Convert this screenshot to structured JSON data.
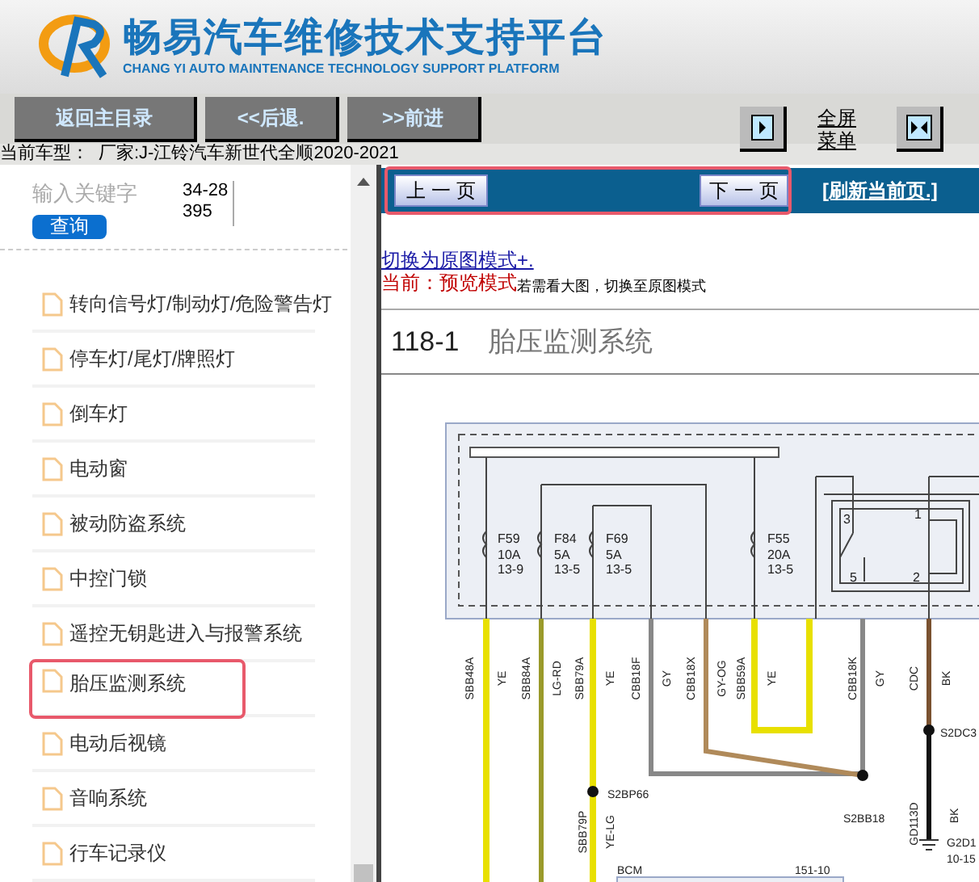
{
  "header": {
    "title": "畅易汽车维修技术支持平台",
    "subtitle": "CHANG YI AUTO MAINTENANCE TECHNOLOGY SUPPORT PLATFORM"
  },
  "toolbar": {
    "buttons": [
      "返回主目录",
      "<<后退.",
      ">>前进"
    ],
    "fullscreen_label": "全屏菜单"
  },
  "car_model": {
    "label": "当前车型：",
    "value": "厂家:J-江铃汽车新世代全顺2020-2021"
  },
  "search": {
    "placeholder": "输入关键字",
    "value": "34-28395",
    "button": "查询"
  },
  "sidebar": {
    "items": [
      {
        "label": "转向信号灯/制动灯/危险警告灯",
        "selected": false
      },
      {
        "label": "停车灯/尾灯/牌照灯",
        "selected": false
      },
      {
        "label": "倒车灯",
        "selected": false
      },
      {
        "label": "电动窗",
        "selected": false
      },
      {
        "label": "被动防盗系统",
        "selected": false
      },
      {
        "label": "中控门锁",
        "selected": false
      },
      {
        "label": "遥控无钥匙进入与报警系统",
        "selected": false
      },
      {
        "label": "胎压监测系统",
        "selected": true
      },
      {
        "label": "电动后视镜",
        "selected": false
      },
      {
        "label": "音响系统",
        "selected": false
      },
      {
        "label": "行车记录仪",
        "selected": false
      }
    ]
  },
  "pager": {
    "prev": "上 一 页",
    "next": "下 一 页",
    "refresh": "[刷新当前页.]",
    "highlighted": true
  },
  "mode_link": "切换为原图模式+.",
  "mode_status": {
    "label": "当前：预览模式",
    "hint": "若需看大图，切换至原图模式"
  },
  "page_title": {
    "number": "118-1",
    "name": "胎压监测系统"
  },
  "diagram": {
    "labels": [
      "F59",
      "10A",
      "13-9",
      "F84",
      "5A",
      "13-5",
      "F69",
      "5A",
      "13-5",
      "F55",
      "20A",
      "13-5",
      "3",
      "1",
      "5",
      "2",
      "SBB48A",
      "YE",
      "SBB84A",
      "LG-RD",
      "SBB79A",
      "YE",
      "CBB18F",
      "GY",
      "CBB18X",
      "GY-OG",
      "SBB59A",
      "YE",
      "CBB18K",
      "GY",
      "CDC",
      "BK",
      "S2BP66",
      "S2BB18",
      "S2DC3",
      "GD113D",
      "BK",
      "SBB79P",
      "YE-LG",
      "G2D1",
      "10-15",
      "BCM",
      "151-10"
    ]
  }
}
